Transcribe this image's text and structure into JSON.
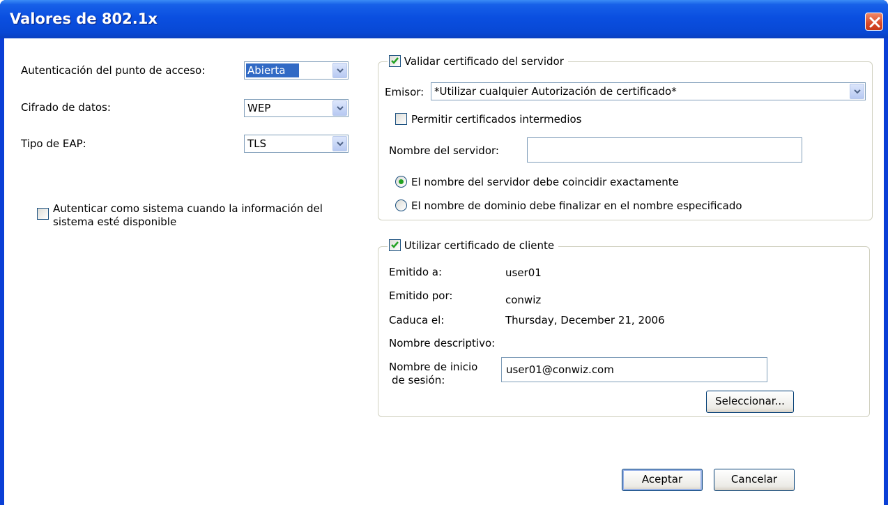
{
  "window": {
    "title": "Valores de 802.1x"
  },
  "left": {
    "auth_label": "Autenticación del punto de acceso:",
    "auth_value": "Abierta",
    "cipher_label": "Cifrado de datos:",
    "cipher_value": "WEP",
    "eap_label": "Tipo de EAP:",
    "eap_value": "TLS",
    "system_auth_line1": "Autenticar como sistema cuando la información del",
    "system_auth_line2": "sistema esté disponible",
    "system_auth_checked": false
  },
  "server_cert": {
    "legend": "Validar certificado del servidor",
    "checked": true,
    "issuer_label": "Emisor:",
    "issuer_value": "*Utilizar cualquier Autorización de certificado*",
    "intermediate_label": "Permitir certificados intermedios",
    "intermediate_checked": false,
    "server_name_label": "Nombre del servidor:",
    "server_name_value": "",
    "match_exact_label": "El nombre del servidor debe coincidir exactamente",
    "match_domain_label": "El nombre de dominio debe finalizar en el nombre especificado",
    "selected_match": "exact"
  },
  "client_cert": {
    "legend": "Utilizar certificado de cliente",
    "checked": true,
    "issued_to_label": "Emitido a:",
    "issued_to_value": "user01",
    "issued_by_label": "Emitido por:",
    "issued_by_value": "conwiz",
    "expires_label": "Caduca el:",
    "expires_value": "Thursday, December 21, 2006",
    "friendly_name_label": "Nombre descriptivo:",
    "logon_label_line1": "Nombre de inicio",
    "logon_label_line2": "de sesión:",
    "logon_value": "user01@conwiz.com",
    "select_button": "Seleccionar..."
  },
  "buttons": {
    "ok": "Aceptar",
    "cancel": "Cancelar"
  },
  "colors": {
    "title_bar": "#0a4fe0",
    "selection": "#316ac5",
    "close": "#d84a2a"
  }
}
